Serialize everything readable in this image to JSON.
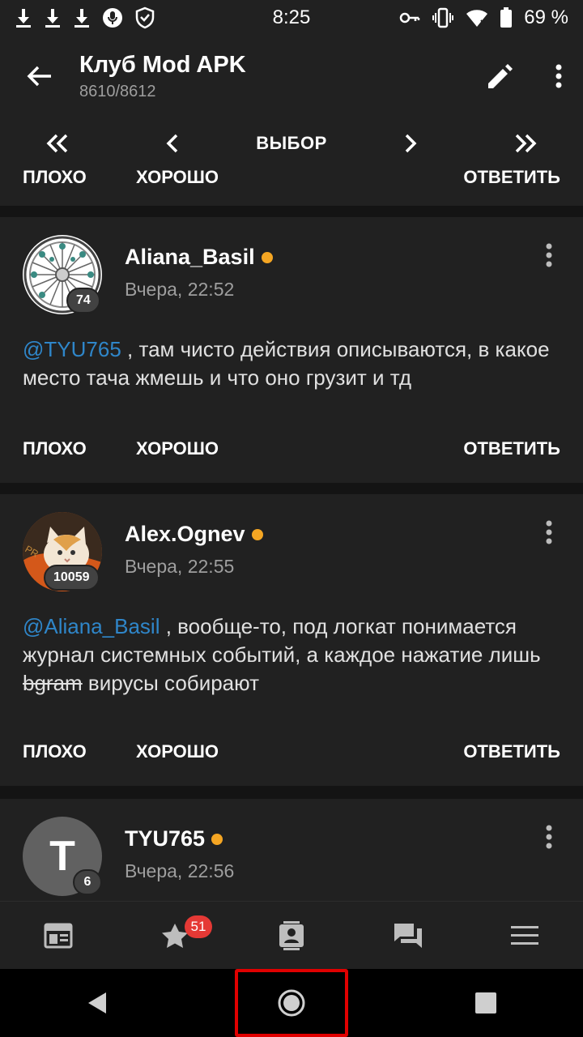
{
  "status_bar": {
    "time": "8:25",
    "battery": "69 %",
    "left_icons": [
      "download-icon",
      "download-icon",
      "download-icon",
      "mic-icon",
      "shield-icon"
    ],
    "right_icons": [
      "key-icon",
      "vibrate-icon",
      "wifi-icon",
      "battery-icon"
    ]
  },
  "app_bar": {
    "title": "Клуб Mod APK",
    "subtitle": "8610/8612"
  },
  "pager": {
    "select_label": "ВЫБОР"
  },
  "post_actions": {
    "bad": "ПЛОХО",
    "good": "ХОРОШО",
    "reply": "ОТВЕТИТЬ"
  },
  "posts": [
    {
      "username": "Aliana_Basil",
      "time": "Вчера, 22:52",
      "badge": "74",
      "mention": "@TYU765",
      "text": " , там чисто действия описываются, в какое место тача жмешь и что оно грузит и тд"
    },
    {
      "username": "Alex.Ognev",
      "time": "Вчера, 22:55",
      "badge": "10059",
      "mention": "@Aliana_Basil",
      "text_before": " , вообще-то, под логкат понимается журнал системных событий, а каждое нажатие лишь ",
      "struck": "bgram",
      "text_after": " вирусы собирают"
    },
    {
      "username": "TYU765",
      "time": "Вчера, 22:56",
      "badge": "6",
      "avatar_letter": "T"
    }
  ],
  "bottom_nav": {
    "favorites_badge": "51"
  },
  "colors": {
    "surface": "#212121",
    "background": "#141414",
    "mention": "#2f86c9",
    "online": "#f5a623",
    "badge_red": "#e53935",
    "highlight": "#e00000"
  }
}
